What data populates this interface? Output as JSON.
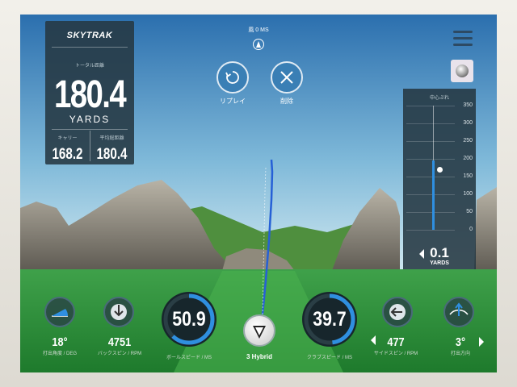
{
  "colors": {
    "sky_top": "#2b6fae",
    "sky_bottom": "#cfe6ef",
    "grass": "#2a8c37",
    "panel": "#263842",
    "accent": "#2f8fe0",
    "trace": "#2660d6"
  },
  "brand": {
    "name": "SKYTRAK"
  },
  "distance": {
    "total_label": "トータル距離",
    "total_value": "180.4",
    "unit": "YARDS",
    "carry_label": "キャリー",
    "carry_value": "168.2",
    "avg_label": "平均総距離",
    "avg_value": "180.4"
  },
  "wind": {
    "label": "風 0 MS",
    "icon": "wind-direction-icon"
  },
  "actions": {
    "replay": {
      "label": "リプレイ",
      "icon": "replay-icon"
    },
    "delete": {
      "label": "削除",
      "icon": "close-icon"
    }
  },
  "menu": {
    "icon": "hamburger-icon"
  },
  "ball_mode": {
    "icon": "golf-ball-icon"
  },
  "deviation": {
    "title": "中心ぶれ",
    "ticks": [
      "350",
      "300",
      "250",
      "200",
      "150",
      "100",
      "50",
      "0"
    ],
    "value": "0.1",
    "unit": "YARDS",
    "fill_yards": 195
  },
  "stats": {
    "launch_angle": {
      "value": "18°",
      "label": "打出角度 / DEG",
      "icon": "launch-angle-icon"
    },
    "back_spin": {
      "value": "4751",
      "label": "バックスピン / RPM",
      "icon": "back-spin-icon"
    },
    "ball_speed": {
      "value": "50.9",
      "label": "ボールスピード / MS",
      "fill": 0.62
    },
    "club": {
      "value": "3 Hybrid",
      "icon": "club-hybrid-icon"
    },
    "club_speed": {
      "value": "39.7",
      "label": "クラブスピード / MS",
      "fill": 0.48
    },
    "side_spin": {
      "value": "477",
      "label": "サイドスピン / RPM",
      "icon": "side-spin-icon"
    },
    "direction": {
      "value": "3°",
      "label": "打出方向",
      "icon": "launch-direction-icon"
    }
  }
}
